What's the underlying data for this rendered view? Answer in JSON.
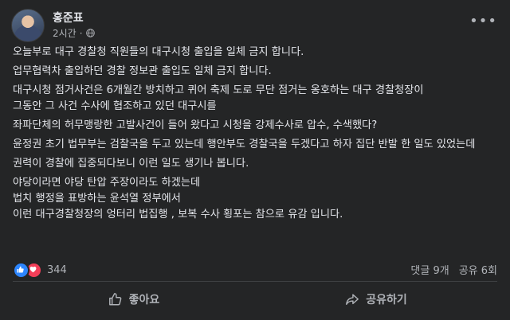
{
  "post": {
    "author": "홍준표",
    "time": "2시간",
    "lines": [
      "오늘부로 대구 경찰청 직원들의 대구시청 출입을 일체 금지 합니다.",
      "업무협력차 출입하던 경찰 정보관 출입도 일체 금지 합니다.",
      "대구시청 점거사건은 6개월간 방치하고 퀴어 축제 도로 무단 점거는 옹호하는 대구 경찰청장이",
      "그동안 그 사건 수사에 협조하고 있던 대구시를",
      "좌파단체의 허무맹랑한 고발사건이 들어 왔다고 시청을 강제수사로 압수, 수색했다?",
      "윤정권 초기 법무부는 검찰국을 두고 있는데 행안부도 경찰국을 두겠다고 하자 집단 반발 한 일도 있었는데",
      "권력이 경찰에 집중되다보니 이런 일도 생기나 봅니다.",
      "야당이라면 야당 탄압 주장이라도 하겠는데",
      "법치 행정을 표방하는 윤석열 정부에서",
      "이런 대구경찰청장의 엉터리 법집행 , 보복 수사 횡포는 참으로 유감 입니다."
    ]
  },
  "stats": {
    "reactions": "344",
    "comments": "댓글 9개",
    "shares": "공유 6회"
  },
  "actions": {
    "like": "좋아요",
    "share": "공유하기"
  },
  "icons": {
    "privacy": "globe-icon",
    "more": "more-horizontal-icon",
    "like_reaction": "thumbs-up-icon",
    "love_reaction": "heart-icon",
    "like_action": "thumbs-up-outline-icon",
    "share_action": "share-arrow-icon"
  },
  "colors": {
    "background": "#242526",
    "text": "#e4e6eb",
    "secondary": "#b0b3b8",
    "like": "#2d86ff",
    "love": "#f33e58"
  }
}
